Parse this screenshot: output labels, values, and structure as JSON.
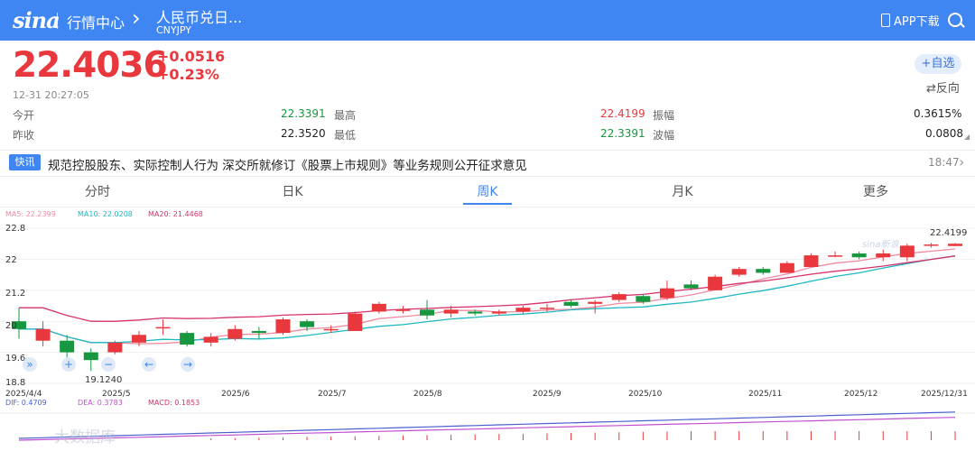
{
  "header": {
    "logo": "sina",
    "section": "行情中心",
    "stock_name": "人民币兑日...",
    "stock_code": "CNYJPY",
    "app_download": "APP下载"
  },
  "quote": {
    "price": "22.4036",
    "change": "+0.0516",
    "change_pct": "+0.23%",
    "timestamp": "12-31  20:27:05",
    "add_watch": "+自选",
    "reverse": "⇄反向"
  },
  "stats": {
    "open_label": "今开",
    "open_value": "22.3391",
    "high_label": "最高",
    "high_value": "22.4199",
    "amplitude_label": "振幅",
    "amplitude_value": "0.3615%",
    "prev_label": "昨收",
    "prev_value": "22.3520",
    "low_label": "最低",
    "low_value": "22.3391",
    "wave_label": "波幅",
    "wave_value": "0.0808"
  },
  "news": {
    "badge": "快讯",
    "text": "规范控股股东、实际控制人行为 深交所就修订《股票上市规则》等业务规则公开征求意见",
    "time": "18:47"
  },
  "tabs": [
    "分时",
    "日K",
    "周K",
    "月K",
    "更多"
  ],
  "active_tab": "周K",
  "indicators": {
    "ma5": "MA5: 22.2399",
    "ma10": "MA10: 22.0208",
    "ma20": "MA20: 21.4468",
    "dif": "DIF: 0.4709",
    "dea": "DEA: 0.3783",
    "macd": "MACD: 0.1853"
  },
  "colors": {
    "up": "#e8383d",
    "down": "#17973f",
    "ma5": "#f08aa0",
    "ma10": "#1fb8c4",
    "ma20": "#d6336c",
    "accent": "#3f86f2"
  },
  "chart_data": {
    "type": "candlestick",
    "y_ticks": [
      "22.8",
      "22",
      "21.2",
      "20",
      "19.6",
      "18.8"
    ],
    "ylim": [
      18.8,
      22.8
    ],
    "x_labels": [
      "2025/4/4",
      "2025/5",
      "2025/6",
      "2025/7",
      "2025/8",
      "2025/9",
      "2025/10",
      "2025/11",
      "2025/12",
      "2025/12/31"
    ],
    "annotations": {
      "max": "22.4199",
      "min": "19.1240"
    },
    "candles": [
      [
        20.4,
        20.2,
        20.75,
        19.95
      ],
      [
        19.9,
        20.2,
        20.4,
        19.75
      ],
      [
        19.9,
        19.6,
        20.05,
        19.4
      ],
      [
        19.6,
        19.4,
        19.7,
        19.12
      ],
      [
        19.6,
        19.85,
        19.9,
        19.55
      ],
      [
        19.85,
        20.05,
        20.15,
        19.75
      ],
      [
        20.25,
        20.25,
        20.45,
        20.05
      ],
      [
        20.1,
        19.8,
        20.15,
        19.75
      ],
      [
        19.85,
        20.0,
        20.1,
        19.75
      ],
      [
        19.95,
        20.2,
        20.3,
        19.9
      ],
      [
        20.15,
        20.1,
        20.25,
        19.95
      ],
      [
        20.1,
        20.45,
        20.5,
        20.05
      ],
      [
        20.4,
        20.25,
        20.45,
        20.15
      ],
      [
        20.2,
        20.2,
        20.3,
        20.1
      ],
      [
        20.15,
        20.6,
        20.65,
        20.15
      ],
      [
        20.65,
        20.85,
        20.9,
        20.6
      ],
      [
        20.7,
        20.7,
        20.8,
        20.6
      ],
      [
        20.7,
        20.55,
        20.95,
        20.45
      ],
      [
        20.6,
        20.7,
        20.8,
        20.5
      ],
      [
        20.65,
        20.6,
        20.7,
        20.55
      ],
      [
        20.6,
        20.65,
        20.7,
        20.55
      ],
      [
        20.65,
        20.75,
        20.8,
        20.6
      ],
      [
        20.75,
        20.75,
        20.85,
        20.65
      ],
      [
        20.9,
        20.8,
        20.95,
        20.75
      ],
      [
        20.85,
        20.9,
        20.95,
        20.6
      ],
      [
        20.95,
        21.1,
        21.15,
        20.9
      ],
      [
        21.05,
        20.9,
        21.1,
        20.85
      ],
      [
        21.0,
        21.25,
        21.45,
        20.95
      ],
      [
        21.35,
        21.25,
        21.45,
        21.2
      ],
      [
        21.2,
        21.55,
        21.6,
        21.2
      ],
      [
        21.6,
        21.75,
        21.8,
        21.55
      ],
      [
        21.75,
        21.65,
        21.8,
        21.6
      ],
      [
        21.65,
        21.9,
        21.95,
        21.65
      ],
      [
        21.8,
        22.1,
        22.15,
        21.8
      ],
      [
        22.1,
        22.1,
        22.2,
        22.05
      ],
      [
        22.15,
        22.05,
        22.2,
        22.0
      ],
      [
        22.05,
        22.15,
        22.25,
        21.95
      ],
      [
        22.05,
        22.35,
        22.4,
        21.95
      ],
      [
        22.35,
        22.38,
        22.42,
        22.3
      ],
      [
        22.34,
        22.4,
        22.42,
        22.34
      ]
    ]
  }
}
